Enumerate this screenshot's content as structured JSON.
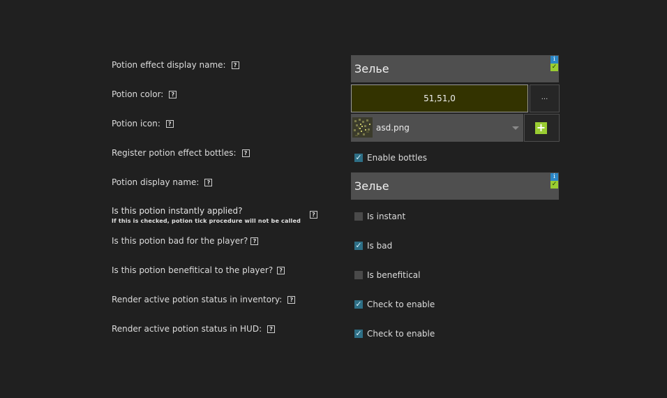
{
  "labels": {
    "effect_display_name": "Potion effect display name:",
    "color": "Potion color:",
    "icon": "Potion icon:",
    "register_bottles": "Register potion effect bottles:",
    "display_name": "Potion display name:",
    "instant_main": "Is this potion instantly applied?",
    "instant_sub": "If this is checked, potion tick procedure will not be called",
    "bad": "Is this potion bad for the player?",
    "beneficial": "Is this potion benefitical to the player?",
    "render_inventory": "Render active potion status in inventory:",
    "render_hud": "Render active potion status in HUD:"
  },
  "help_glyph": "?",
  "fields": {
    "effect_display_name": "Зелье",
    "color_value": "51,51,0",
    "color_hex": "#333300",
    "color_picker_label": "...",
    "icon_file": "asd.png",
    "display_name": "Зелье",
    "info_badge": "i",
    "ok_badge": "✓",
    "add_glyph": "+"
  },
  "checkboxes": {
    "bottles": {
      "label": "Enable bottles",
      "checked": true
    },
    "instant": {
      "label": "Is instant",
      "checked": false
    },
    "bad": {
      "label": "Is bad",
      "checked": true
    },
    "beneficial": {
      "label": "Is benefitical",
      "checked": false
    },
    "inventory": {
      "label": "Check to enable",
      "checked": true
    },
    "hud": {
      "label": "Check to enable",
      "checked": true
    }
  },
  "check_glyph": "✓",
  "icons": {
    "help": "help-icon",
    "info": "info-icon",
    "valid": "checkmark-icon",
    "dropdown": "chevron-down-icon",
    "add": "plus-icon"
  },
  "colors": {
    "background": "#202020",
    "field": "#4f4f4f",
    "accent_green": "#9acd32",
    "accent_blue": "#2b86c5",
    "checkbox_on": "#2e6f86"
  }
}
